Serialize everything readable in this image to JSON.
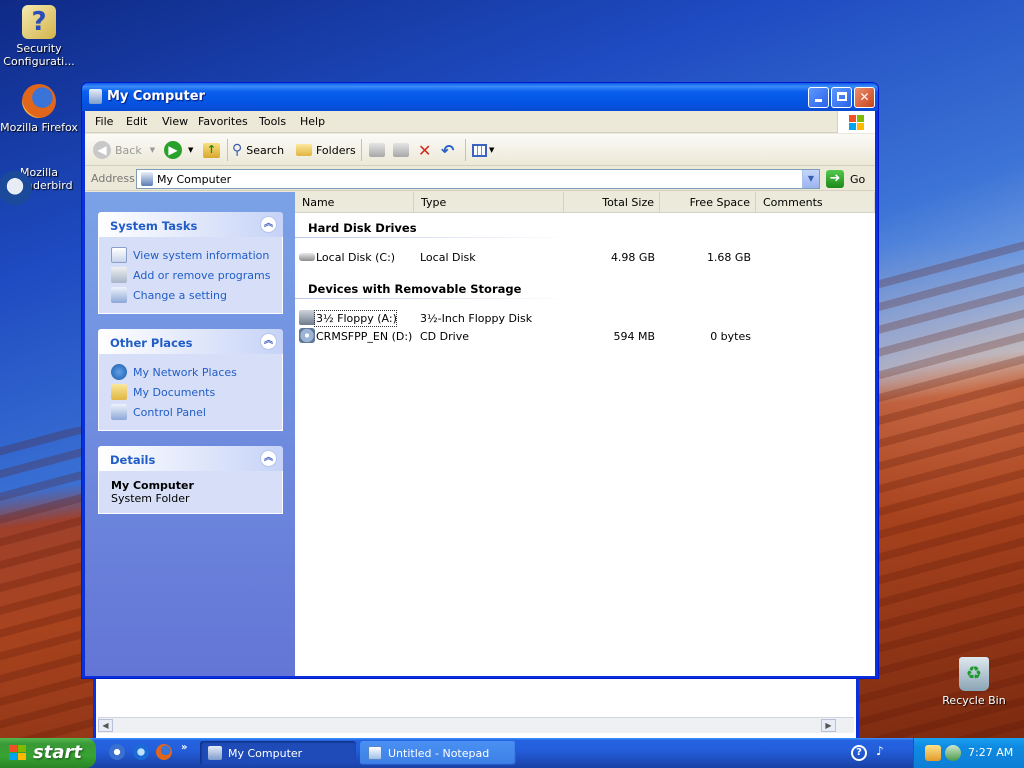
{
  "desktop": {
    "icons": [
      {
        "label": "Security Configurati...",
        "icon": "security-config-icon"
      },
      {
        "label": "Mozilla Firefox",
        "icon": "firefox-icon"
      },
      {
        "label": "Mozilla Thunderbird",
        "icon": "thunderbird-icon"
      },
      {
        "label": "Recycle Bin",
        "icon": "recycle-bin-icon"
      }
    ]
  },
  "window": {
    "title": "My Computer",
    "menu": [
      "File",
      "Edit",
      "View",
      "Favorites",
      "Tools",
      "Help"
    ],
    "toolbar": {
      "back": "Back",
      "search": "Search",
      "folders": "Folders"
    },
    "address": {
      "label": "Address",
      "value": "My Computer",
      "go": "Go"
    },
    "tasks": {
      "system_tasks": {
        "title": "System Tasks",
        "items": [
          "View system information",
          "Add or remove programs",
          "Change a setting"
        ]
      },
      "other_places": {
        "title": "Other Places",
        "items": [
          "My Network Places",
          "My Documents",
          "Control Panel"
        ]
      },
      "details": {
        "title": "Details",
        "name": "My Computer",
        "type": "System Folder"
      }
    },
    "columns": [
      "Name",
      "Type",
      "Total Size",
      "Free Space",
      "Comments"
    ],
    "groups": [
      {
        "title": "Hard Disk Drives",
        "items": [
          {
            "name": "Local Disk (C:)",
            "type": "Local Disk",
            "total": "4.98 GB",
            "free": "1.68 GB",
            "icon": "hard-disk-icon"
          }
        ]
      },
      {
        "title": "Devices with Removable Storage",
        "items": [
          {
            "name": "3½ Floppy (A:)",
            "type": "3½-Inch Floppy Disk",
            "total": "",
            "free": "",
            "icon": "floppy-drive-icon"
          },
          {
            "name": "CRMSFPP_EN (D:)",
            "type": "CD Drive",
            "total": "594 MB",
            "free": "0 bytes",
            "icon": "cd-drive-icon"
          }
        ]
      }
    ]
  },
  "taskbar": {
    "start": "start",
    "tasks": [
      {
        "label": "My Computer",
        "active": true
      },
      {
        "label": "Untitled - Notepad",
        "active": false
      }
    ],
    "clock": "7:27 AM",
    "more": "»",
    "help": "?"
  },
  "colors": {
    "xp_blue": "#0831d9",
    "task_link": "#215dc6",
    "start_green": "#3a9a37"
  }
}
